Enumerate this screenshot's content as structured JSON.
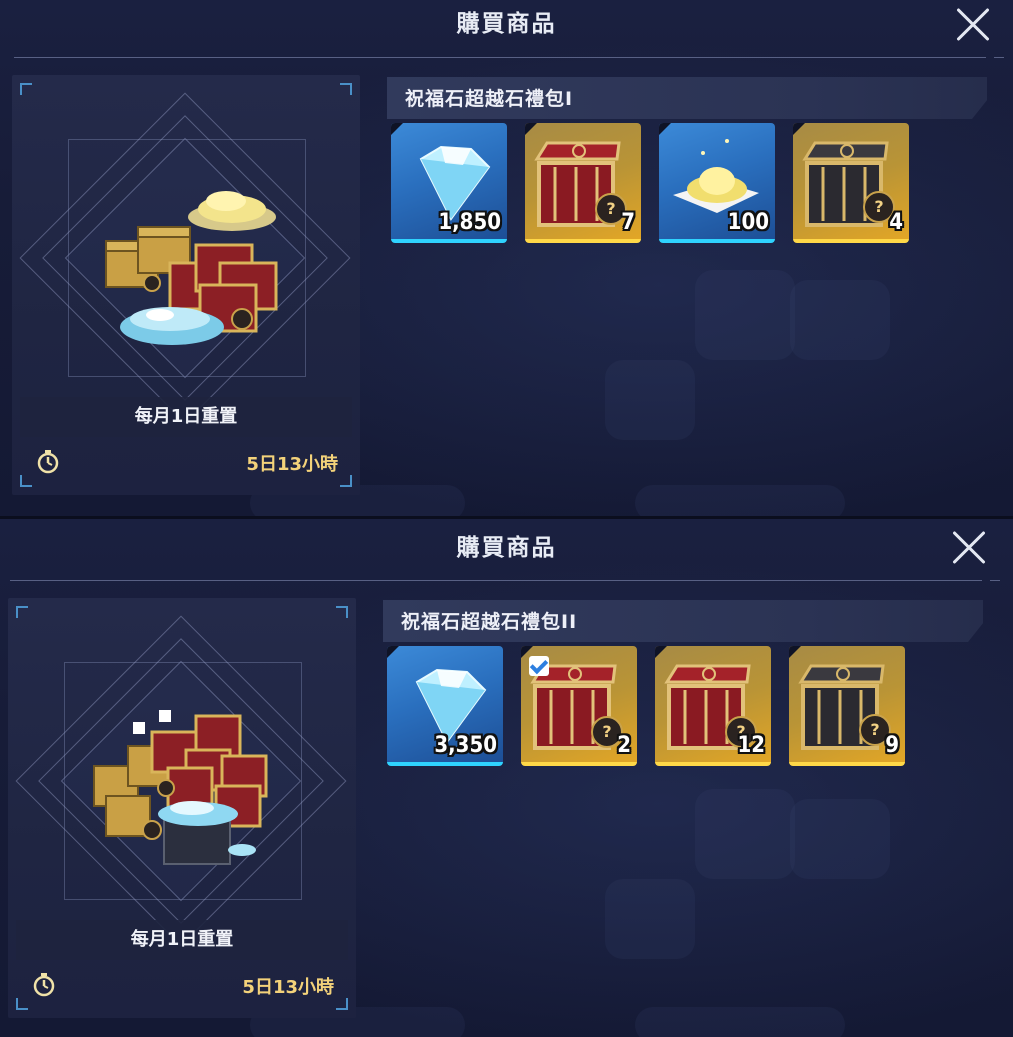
{
  "colors": {
    "accent_blue": "#2fd3ff",
    "accent_gold": "#ffd848",
    "timer_text": "#f3d27a"
  },
  "panels": [
    {
      "title": "購買商品",
      "bundle_name": "祝福石超越石禮包I",
      "reset_text": "每月1日重置",
      "timer": "5日13小時",
      "items": [
        {
          "type": "blue",
          "icon": "diamond-icon",
          "qty": "1,850"
        },
        {
          "type": "gold",
          "icon": "red-chest-icon",
          "qty": "7"
        },
        {
          "type": "blue",
          "icon": "gold-dust-icon",
          "qty": "100"
        },
        {
          "type": "gold",
          "icon": "dark-chest-icon",
          "qty": "4"
        }
      ]
    },
    {
      "title": "購買商品",
      "bundle_name": "祝福石超越石禮包II",
      "reset_text": "每月1日重置",
      "timer": "5日13小時",
      "items": [
        {
          "type": "blue",
          "icon": "diamond-icon",
          "qty": "3,350"
        },
        {
          "type": "gold",
          "icon": "red-chest-icon",
          "qty": "2",
          "checked": true
        },
        {
          "type": "gold",
          "icon": "red-chest-icon",
          "qty": "12"
        },
        {
          "type": "gold",
          "icon": "dark-chest-icon",
          "qty": "9"
        }
      ]
    }
  ]
}
